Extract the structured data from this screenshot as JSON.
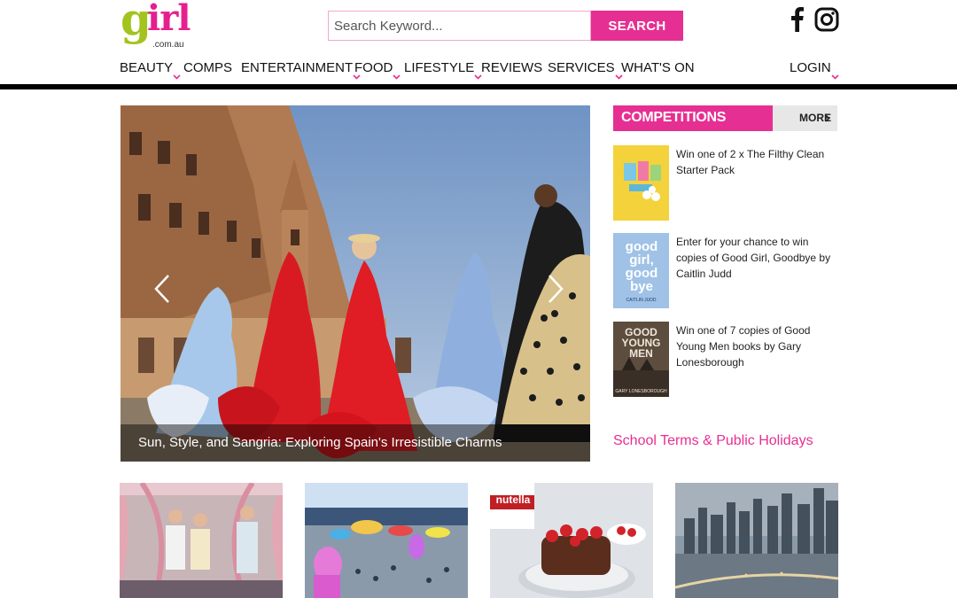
{
  "site": {
    "logo_g": "g",
    "logo_irl": "irl",
    "logo_sub": ".com.au"
  },
  "search": {
    "placeholder": "Search Keyword...",
    "button_label": "SEARCH"
  },
  "social": [
    "facebook-icon",
    "instagram-icon"
  ],
  "nav": {
    "items": [
      {
        "label": "BEAUTY",
        "dropdown": true
      },
      {
        "label": "COMPS",
        "dropdown": false
      },
      {
        "label": "ENTERTAINMENT",
        "dropdown": true
      },
      {
        "label": "FOOD",
        "dropdown": true
      },
      {
        "label": "LIFESTYLE",
        "dropdown": true
      },
      {
        "label": "REVIEWS",
        "dropdown": false
      },
      {
        "label": "SERVICES",
        "dropdown": true
      },
      {
        "label": "WHAT'S ON",
        "dropdown": false
      }
    ],
    "login": "LOGIN"
  },
  "hero": {
    "caption": "Sun, Style, and Sangria: Exploring Spain's Irresistible Charms"
  },
  "competitions": {
    "title": "COMPETITIONS",
    "more_label": "MORE",
    "items": [
      {
        "text": "Win one of 2 x The Filthy Clean Starter Pack"
      },
      {
        "text": "Enter for your chance to win copies of Good Girl, Goodbye by Caitlin Judd",
        "cover_text": "good girl, good bye",
        "cover_author": "CAITLIN JUDD"
      },
      {
        "text": "Win one of 7 copies of Good Young Men books by Gary Lonesborough",
        "cover_text": "GOOD YOUNG MEN",
        "cover_author": "GARY LONESBOROUGH"
      }
    ]
  },
  "holidays_link": "School Terms & Public Holidays",
  "tiles": [
    {
      "name": "tile-fashion"
    },
    {
      "name": "tile-festival"
    },
    {
      "name": "tile-pancakes",
      "label_text": "nutella"
    },
    {
      "name": "tile-city"
    }
  ],
  "colors": {
    "brand_pink": "#e62f92",
    "logo_green": "#a3c31e"
  }
}
